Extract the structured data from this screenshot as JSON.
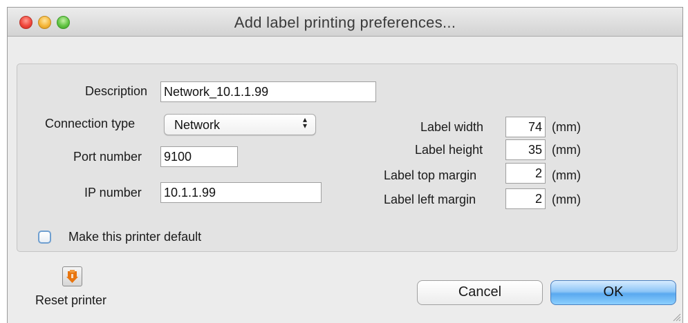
{
  "window": {
    "title": "Add label printing preferences..."
  },
  "form": {
    "description_label": "Description",
    "description_value": "Network_10.1.1.99",
    "connection_type_label": "Connection type",
    "connection_type_value": "Network",
    "port_number_label": "Port number",
    "port_number_value": "9100",
    "ip_number_label": "IP number",
    "ip_number_value": "10.1.1.99",
    "label_width_label": "Label width",
    "label_width_value": "74",
    "label_height_label": "Label height",
    "label_height_value": "35",
    "label_top_margin_label": "Label top margin",
    "label_top_margin_value": "2",
    "label_left_margin_label": "Label left margin",
    "label_left_margin_value": "2",
    "unit": "(mm)",
    "default_checkbox_label": "Make this printer default",
    "default_checked": false
  },
  "footer": {
    "reset_label": "Reset printer",
    "reset_icon": "reset-printer-icon",
    "cancel_label": "Cancel",
    "ok_label": "OK"
  },
  "colors": {
    "ok_button": "#5aa9ef",
    "close_light": "#f0473c",
    "minimize_light": "#f5b73a",
    "maximize_light": "#62c544",
    "reset_icon_orange": "#e8750f"
  }
}
